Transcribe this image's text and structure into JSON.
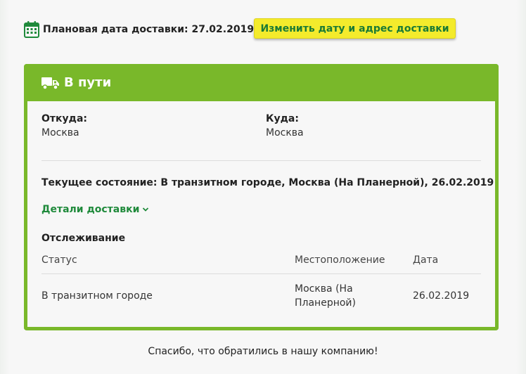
{
  "delivery": {
    "planned_label": "Плановая дата доставки: 27.02.2019",
    "change_button": "Изменить дату и адрес доставки"
  },
  "card": {
    "title": "В пути",
    "from_label": "Откуда:",
    "from_value": "Москва",
    "to_label": "Куда:",
    "to_value": "Москва",
    "current_state": "Текущее состояние: В транзитном городе, Москва (На Планерной), 26.02.2019",
    "details_link": "Детали доставки",
    "tracking_title": "Отслеживание",
    "columns": [
      "Статус",
      "Местоположение",
      "Дата"
    ],
    "rows": [
      {
        "status": "В транзитном городе",
        "location_line1": "Москва (На",
        "location_line2": "Планерной)",
        "date": "26.02.2019"
      }
    ]
  },
  "footer": {
    "text": "Спасибо, что обратились в нашу компанию!"
  },
  "colors": {
    "accent_green": "#79b82a",
    "link_green": "#1f8a3b",
    "button_yellow": "#f4eb2c"
  },
  "icons": {
    "calendar": "calendar-icon",
    "truck": "truck-icon",
    "chevron": "chevron-down-icon"
  }
}
